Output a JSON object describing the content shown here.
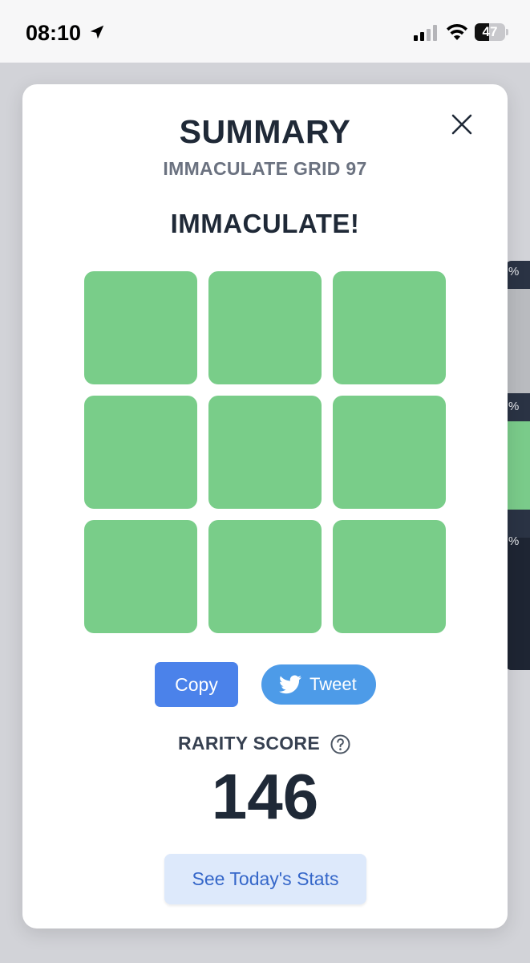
{
  "status_bar": {
    "time": "08:10",
    "battery_level": "47",
    "icons": [
      "location-arrow-icon",
      "cellular-signal-icon",
      "wifi-icon",
      "battery-icon"
    ]
  },
  "background": {
    "percent_label": "%"
  },
  "modal": {
    "title": "SUMMARY",
    "subtitle": "IMMACULATE GRID 97",
    "result": "IMMACULATE!",
    "grid": {
      "rows": 3,
      "cols": 3,
      "cells": [
        "correct",
        "correct",
        "correct",
        "correct",
        "correct",
        "correct",
        "correct",
        "correct",
        "correct"
      ],
      "correct_color": "#79cd89"
    },
    "copy_label": "Copy",
    "tweet_label": "Tweet",
    "rarity_label": "RARITY SCORE",
    "rarity_score": "146",
    "stats_label": "See Today's Stats"
  },
  "colors": {
    "copy_button": "#4b82ea",
    "tweet_button": "#4d9be8",
    "stats_button_bg": "#dde9fb",
    "stats_button_text": "#3567c9",
    "title_text": "#1f2937"
  }
}
